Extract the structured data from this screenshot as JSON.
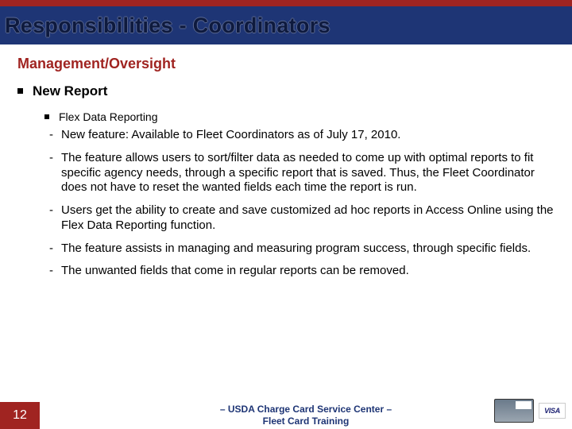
{
  "header": {
    "title": "Responsibilities - Coordinators"
  },
  "section": {
    "heading": "Management/Oversight"
  },
  "bullets": {
    "l1": "New Report",
    "l2": "Flex Data Reporting",
    "l3": [
      "New feature: Available to Fleet Coordinators as of July 17, 2010.",
      "The feature allows users to sort/filter data as needed to come up with optimal reports to fit specific agency needs, through a specific report that is saved.  Thus, the Fleet Coordinator does not have to reset the wanted fields each time the report is run.",
      "Users get the ability to create and save customized ad hoc reports in Access Online using the Flex Data Reporting function.",
      "The feature assists in managing and measuring program success, through specific fields.",
      "The unwanted fields that come in regular reports can be removed."
    ]
  },
  "footer": {
    "page": "12",
    "line1": "– USDA Charge Card Service Center –",
    "line2": "Fleet Card Training",
    "visa": "VISA"
  }
}
